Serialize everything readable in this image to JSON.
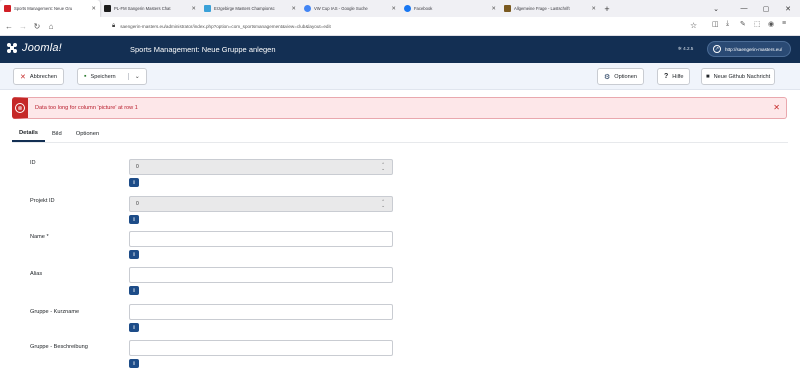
{
  "browser": {
    "tabs": [
      {
        "title": "Sports Management: Neue Gru",
        "favicon_color": "#d11f26",
        "active": true
      },
      {
        "title": "PL-FM Sangerin Masters Chat",
        "favicon_color": "#1c1c1c",
        "active": false
      },
      {
        "title": "Erzgebirge Masters Championsc",
        "favicon_color": "#3aa1d8",
        "active": false
      },
      {
        "title": "VW Cup IAS - Google Suche",
        "favicon_color": "#4285f4",
        "active": false
      },
      {
        "title": "Facebook",
        "favicon_color": "#1877f2",
        "active": false
      },
      {
        "title": "Allgemeine Frage - Lastschrift",
        "favicon_color": "#7a5a20",
        "active": false
      }
    ],
    "new_tab_label": "+",
    "url": "saengerin-masters.eu/administrator/index.php?option=com_sportsmanagement&view=club&layout=edit",
    "window_controls": [
      "⌄",
      "—",
      "▢",
      "✕"
    ]
  },
  "joomla": {
    "logo_text": "Joomla!",
    "page_title": "Sports Management: Neue Gruppe anlegen",
    "version": "4.2.5",
    "site_link": "http://saengerin-masters.eu/"
  },
  "toolbar": {
    "cancel_label": "Abbrechen",
    "save_label": "Speichern",
    "options_label": "Optionen",
    "help_label": "Hilfe",
    "github_label": "Neue Github Nachricht"
  },
  "alert": {
    "message": "Data too long for column 'picture' at row 1"
  },
  "tabs": [
    "Details",
    "Bild",
    "Optionen"
  ],
  "form": {
    "fields": [
      {
        "label": "ID",
        "value": "0",
        "readonly": true
      },
      {
        "label": "Projekt ID",
        "value": "0",
        "readonly": true
      },
      {
        "label": "Name *",
        "value": "",
        "readonly": false
      },
      {
        "label": "Alias",
        "value": "",
        "readonly": false
      },
      {
        "label": "Gruppe - Kurzname",
        "value": "",
        "readonly": false
      },
      {
        "label": "Gruppe - Beschreibung",
        "value": "",
        "readonly": false
      }
    ],
    "help_glyph": "i"
  },
  "colors": {
    "header_bg": "#132f53",
    "alert_bg": "#fde7e9",
    "alert_accent": "#c52827",
    "cancel_icon": "#c52827",
    "save_icon": "#2f7d32",
    "help_button": "#1d4c88"
  }
}
